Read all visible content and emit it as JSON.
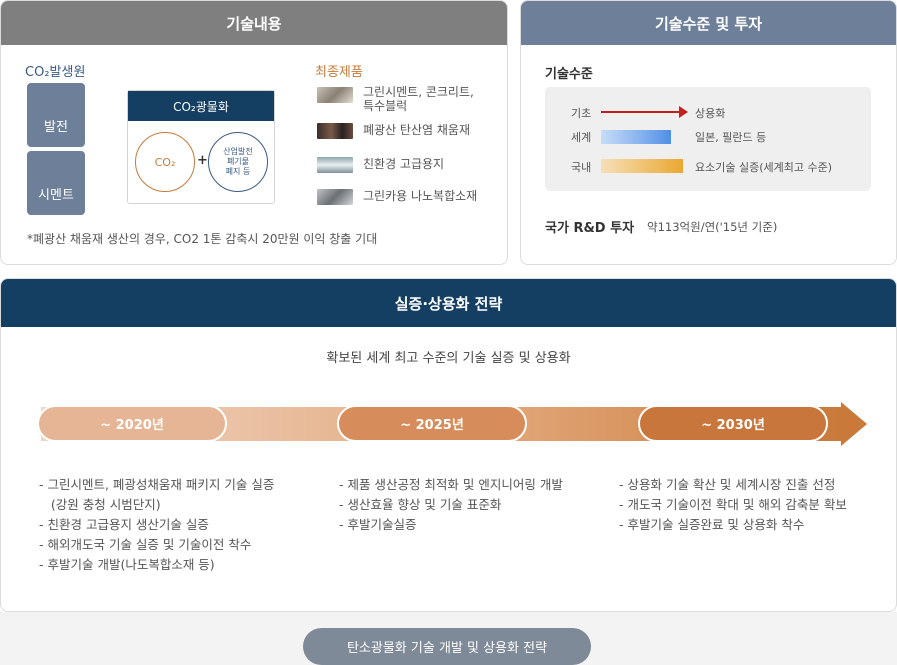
{
  "left_panel": {
    "title": "기술내용",
    "sources_title": "CO₂발생원",
    "sources": [
      "발전",
      "시멘트"
    ],
    "process": {
      "title": "CO₂광물화",
      "input_a": "CO₂",
      "plus": "+",
      "input_b": "산업발전\n폐기물\n폐지 등"
    },
    "products_title": "최종제품",
    "products": [
      "그린시멘트, 콘크리트,\n특수블럭",
      "폐광산 탄산염 채움재",
      "친환경 고급용지",
      "그린카용 나노복합소재"
    ],
    "footnote": "*폐광산 채움재 생산의 경우, CO2  1톤 감축시 20만원 이익 창출 기대"
  },
  "right_panel": {
    "title": "기술수준 및 투자",
    "level_title": "기술수준",
    "rows": [
      {
        "label": "기초",
        "value": "상용화"
      },
      {
        "label": "세계",
        "value": "일본, 필란드 등"
      },
      {
        "label": "국내",
        "value": "요소기술 실증(세계최고 수준)"
      }
    ],
    "rnd_label": "국가 R&D 투자",
    "rnd_value": "약113억원/연('15년 기준)"
  },
  "strategy": {
    "title": "실증·상용화 전략",
    "subtitle": "확보된 세계 최고 수준의 기술 실증 및 상용화",
    "stages": [
      {
        "label": "~ 2020년",
        "items": [
          "- 그린시멘트, 폐광성채움재 패키지 기술 실증",
          "   (강원 충청 시범단지)",
          "- 친환경 고급용지 생산기술 실증",
          "- 해외개도국 기술 실증 및 기술이전 착수",
          "- 후발기술 개발(나도복합소재 등)"
        ]
      },
      {
        "label": "~ 2025년",
        "items": [
          "- 제품 생산공정 최적화 및 엔지니어링 개발",
          "- 생산효율 향상 및 기술 표준화",
          "- 후발기술실증"
        ]
      },
      {
        "label": "~ 2030년",
        "items": [
          "- 상용화 기술 확산 및 세계시장 진출 선정",
          "- 개도국 기술이전 확대 및 해외 감축분 확보",
          "- 후발기술 실증완료 및 상용화 착수"
        ]
      }
    ]
  },
  "caption": "탄소광물화 기술 개발 및 상용화 전략",
  "colors": {
    "navy": "#143f63",
    "slate": "#6e7f99",
    "gray": "#7f7f80",
    "orange": "#c97a3a",
    "red_arrow": "#c41f1f"
  }
}
